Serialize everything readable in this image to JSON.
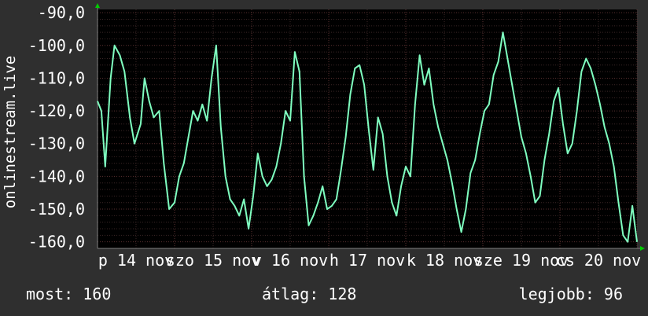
{
  "chart_data": {
    "type": "line",
    "ylabel": "onlinestream.live",
    "ylim": [
      -162,
      -89
    ],
    "y_ticks": [
      "-90,0",
      "-100,0",
      "-110,0",
      "-120,0",
      "-130,0",
      "-140,0",
      "-150,0",
      "-160,0"
    ],
    "y_tick_values": [
      -90,
      -100,
      -110,
      -120,
      -130,
      -140,
      -150,
      -160
    ],
    "x_ticks": [
      "p 14 nov",
      "szo 15 nov",
      "v 16 nov",
      "h 17 nov",
      "k 18 nov",
      "sze 19 nov",
      "cs 20 nov"
    ],
    "x_tick_positions": [
      0.5,
      1.5,
      2.5,
      3.5,
      4.5,
      5.5,
      6.5
    ],
    "xlim": [
      0,
      7
    ],
    "grid": true,
    "line_color": "#7fffc0",
    "series": [
      {
        "x": [
          0.0,
          0.05,
          0.1,
          0.17,
          0.22,
          0.29,
          0.35,
          0.42,
          0.48,
          0.56,
          0.61,
          0.67,
          0.73,
          0.8,
          0.86,
          0.93,
          1.0,
          1.06,
          1.12,
          1.18,
          1.24,
          1.3,
          1.36,
          1.42,
          1.48,
          1.54,
          1.6,
          1.66,
          1.72,
          1.78,
          1.84,
          1.9,
          1.96,
          2.02,
          2.08,
          2.14,
          2.2,
          2.26,
          2.32,
          2.38,
          2.44,
          2.5,
          2.56,
          2.62,
          2.68,
          2.74,
          2.8,
          2.86,
          2.92,
          2.98,
          3.04,
          3.1,
          3.16,
          3.22,
          3.28,
          3.34,
          3.4,
          3.46,
          3.52,
          3.58,
          3.64,
          3.7,
          3.76,
          3.82,
          3.88,
          3.94,
          4.0,
          4.06,
          4.12,
          4.18,
          4.24,
          4.3,
          4.36,
          4.42,
          4.48,
          4.54,
          4.6,
          4.66,
          4.72,
          4.78,
          4.84,
          4.9,
          4.96,
          5.02,
          5.08,
          5.14,
          5.2,
          5.26,
          5.32,
          5.38,
          5.44,
          5.5,
          5.56,
          5.62,
          5.68,
          5.74,
          5.8,
          5.86,
          5.92,
          5.98,
          6.04,
          6.1,
          6.16,
          6.22,
          6.28,
          6.34,
          6.4,
          6.46,
          6.52,
          6.58,
          6.64,
          6.7,
          6.76,
          6.82,
          6.88,
          6.94,
          7.0
        ],
        "y": [
          -117,
          -120,
          -137,
          -110,
          -100,
          -103,
          -108,
          -122,
          -130,
          -124,
          -110,
          -117,
          -122,
          -120,
          -136,
          -150,
          -148,
          -140,
          -136,
          -128,
          -120,
          -123,
          -118,
          -123,
          -110,
          -100,
          -125,
          -140,
          -147,
          -149,
          -152,
          -147,
          -156,
          -146,
          -133,
          -140,
          -143,
          -141,
          -137,
          -130,
          -120,
          -123,
          -102,
          -108,
          -140,
          -155,
          -152,
          -148,
          -143,
          -150,
          -149,
          -147,
          -138,
          -128,
          -115,
          -107,
          -106,
          -112,
          -126,
          -138,
          -122,
          -127,
          -140,
          -148,
          -152,
          -143,
          -137,
          -140,
          -118,
          -103,
          -112,
          -107,
          -118,
          -125,
          -130,
          -135,
          -142,
          -150,
          -157,
          -150,
          -139,
          -135,
          -127,
          -120,
          -118,
          -109,
          -105,
          -96,
          -104,
          -112,
          -120,
          -128,
          -133,
          -140,
          -148,
          -146,
          -135,
          -127,
          -117,
          -113,
          -124,
          -133,
          -130,
          -120,
          -108,
          -104,
          -107,
          -112,
          -118,
          -125,
          -130,
          -137,
          -148,
          -158,
          -160,
          -149,
          -160
        ]
      }
    ],
    "stats": {
      "now_label": "most:",
      "now_value": "160",
      "avg_label": "átlag:",
      "avg_value": "128",
      "best_label": "legjobb:",
      "best_value": "96"
    }
  }
}
